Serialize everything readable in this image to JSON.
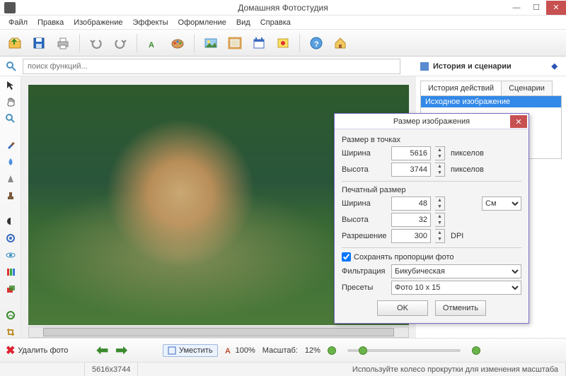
{
  "title": "Домашняя Фотостудия",
  "menu": [
    "Файл",
    "Правка",
    "Изображение",
    "Эффекты",
    "Оформление",
    "Вид",
    "Справка"
  ],
  "search_placeholder": "поиск функций...",
  "side": {
    "title": "История и сценарии",
    "tabs": [
      "История действий",
      "Сценарии"
    ],
    "item": "Исходное изображение"
  },
  "bottom": {
    "delete": "Удалить фото",
    "fit": "Уместить",
    "zoom100": "100%",
    "scale_label": "Масштаб:",
    "scale_value": "12%"
  },
  "status": {
    "dims": "5616x3744",
    "hint": "Используйте колесо прокрутки для изменения масштаба"
  },
  "dialog": {
    "title": "Размер изображения",
    "pixel_group": "Размер в точках",
    "width_l": "Ширина",
    "height_l": "Высота",
    "width_px": "5616",
    "height_px": "3744",
    "px_unit": "пикселов",
    "print_group": "Печатный размер",
    "width_cm": "48",
    "height_cm": "32",
    "cm_unit": "См",
    "res_l": "Разрешение",
    "res_v": "300",
    "dpi": "DPI",
    "keep": "Сохранять пропорции фото",
    "filter_l": "Фильтрация",
    "filter_v": "Бикубическая",
    "preset_l": "Пресеты",
    "preset_v": "Фото 10 x 15",
    "ok": "OK",
    "cancel": "Отменить"
  }
}
